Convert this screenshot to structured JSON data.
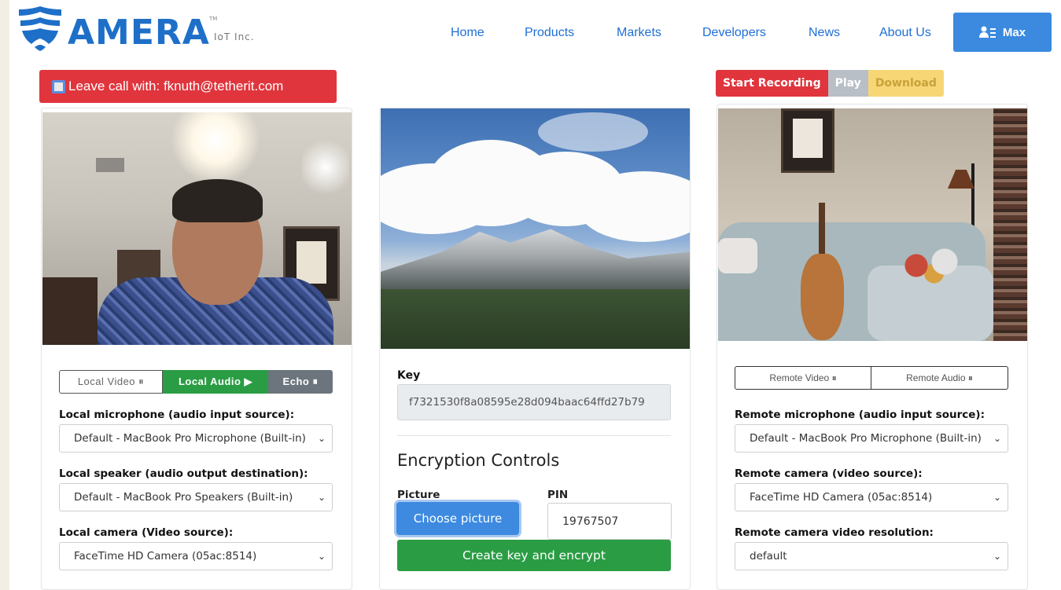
{
  "header": {
    "brand": "AMERA",
    "brand_sub": "IoT Inc.",
    "brand_tm": "TM",
    "nav": [
      "Home",
      "Products",
      "Markets",
      "Developers",
      "News",
      "About Us"
    ],
    "user_label": "Max",
    "colors": {
      "brand": "#1e6fc8",
      "nav": "#1f6fd6",
      "user_button": "#3b8ae0"
    }
  },
  "call": {
    "leave_label": "Leave call with: fknuth@tetherit.com"
  },
  "recording": {
    "start_label": "Start Recording",
    "play_label": "Play",
    "download_label": "Download"
  },
  "local": {
    "toggles": {
      "video_label": "Local Video ⏸",
      "audio_label": "Local Audio ▶",
      "echo_label": "Echo ⏸"
    },
    "mic_label": "Local microphone (audio input source):",
    "mic_value": "Default - MacBook Pro Microphone (Built-in)",
    "speaker_label": "Local speaker (audio output destination):",
    "speaker_value": "Default - MacBook Pro Speakers (Built-in)",
    "camera_label": "Local camera (Video source):",
    "camera_value": "FaceTime HD Camera (05ac:8514)"
  },
  "encryption": {
    "key_label": "Key",
    "key_value": "f7321530f8a08595e28d094baac64ffd27b79",
    "title": "Encryption Controls",
    "picture_label": "Picture",
    "choose_label": "Choose picture",
    "pin_label": "PIN",
    "pin_value": "19767507",
    "create_label": "Create key and encrypt"
  },
  "remote": {
    "toggles": {
      "video_label": "Remote Video ⏸",
      "audio_label": "Remote Audio ⏸"
    },
    "mic_label": "Remote microphone (audio input source):",
    "mic_value": "Default - MacBook Pro Microphone (Built-in)",
    "camera_label": "Remote camera (video source):",
    "camera_value": "FaceTime HD Camera (05ac:8514)",
    "resolution_label": "Remote camera video resolution:",
    "resolution_value": "default"
  }
}
